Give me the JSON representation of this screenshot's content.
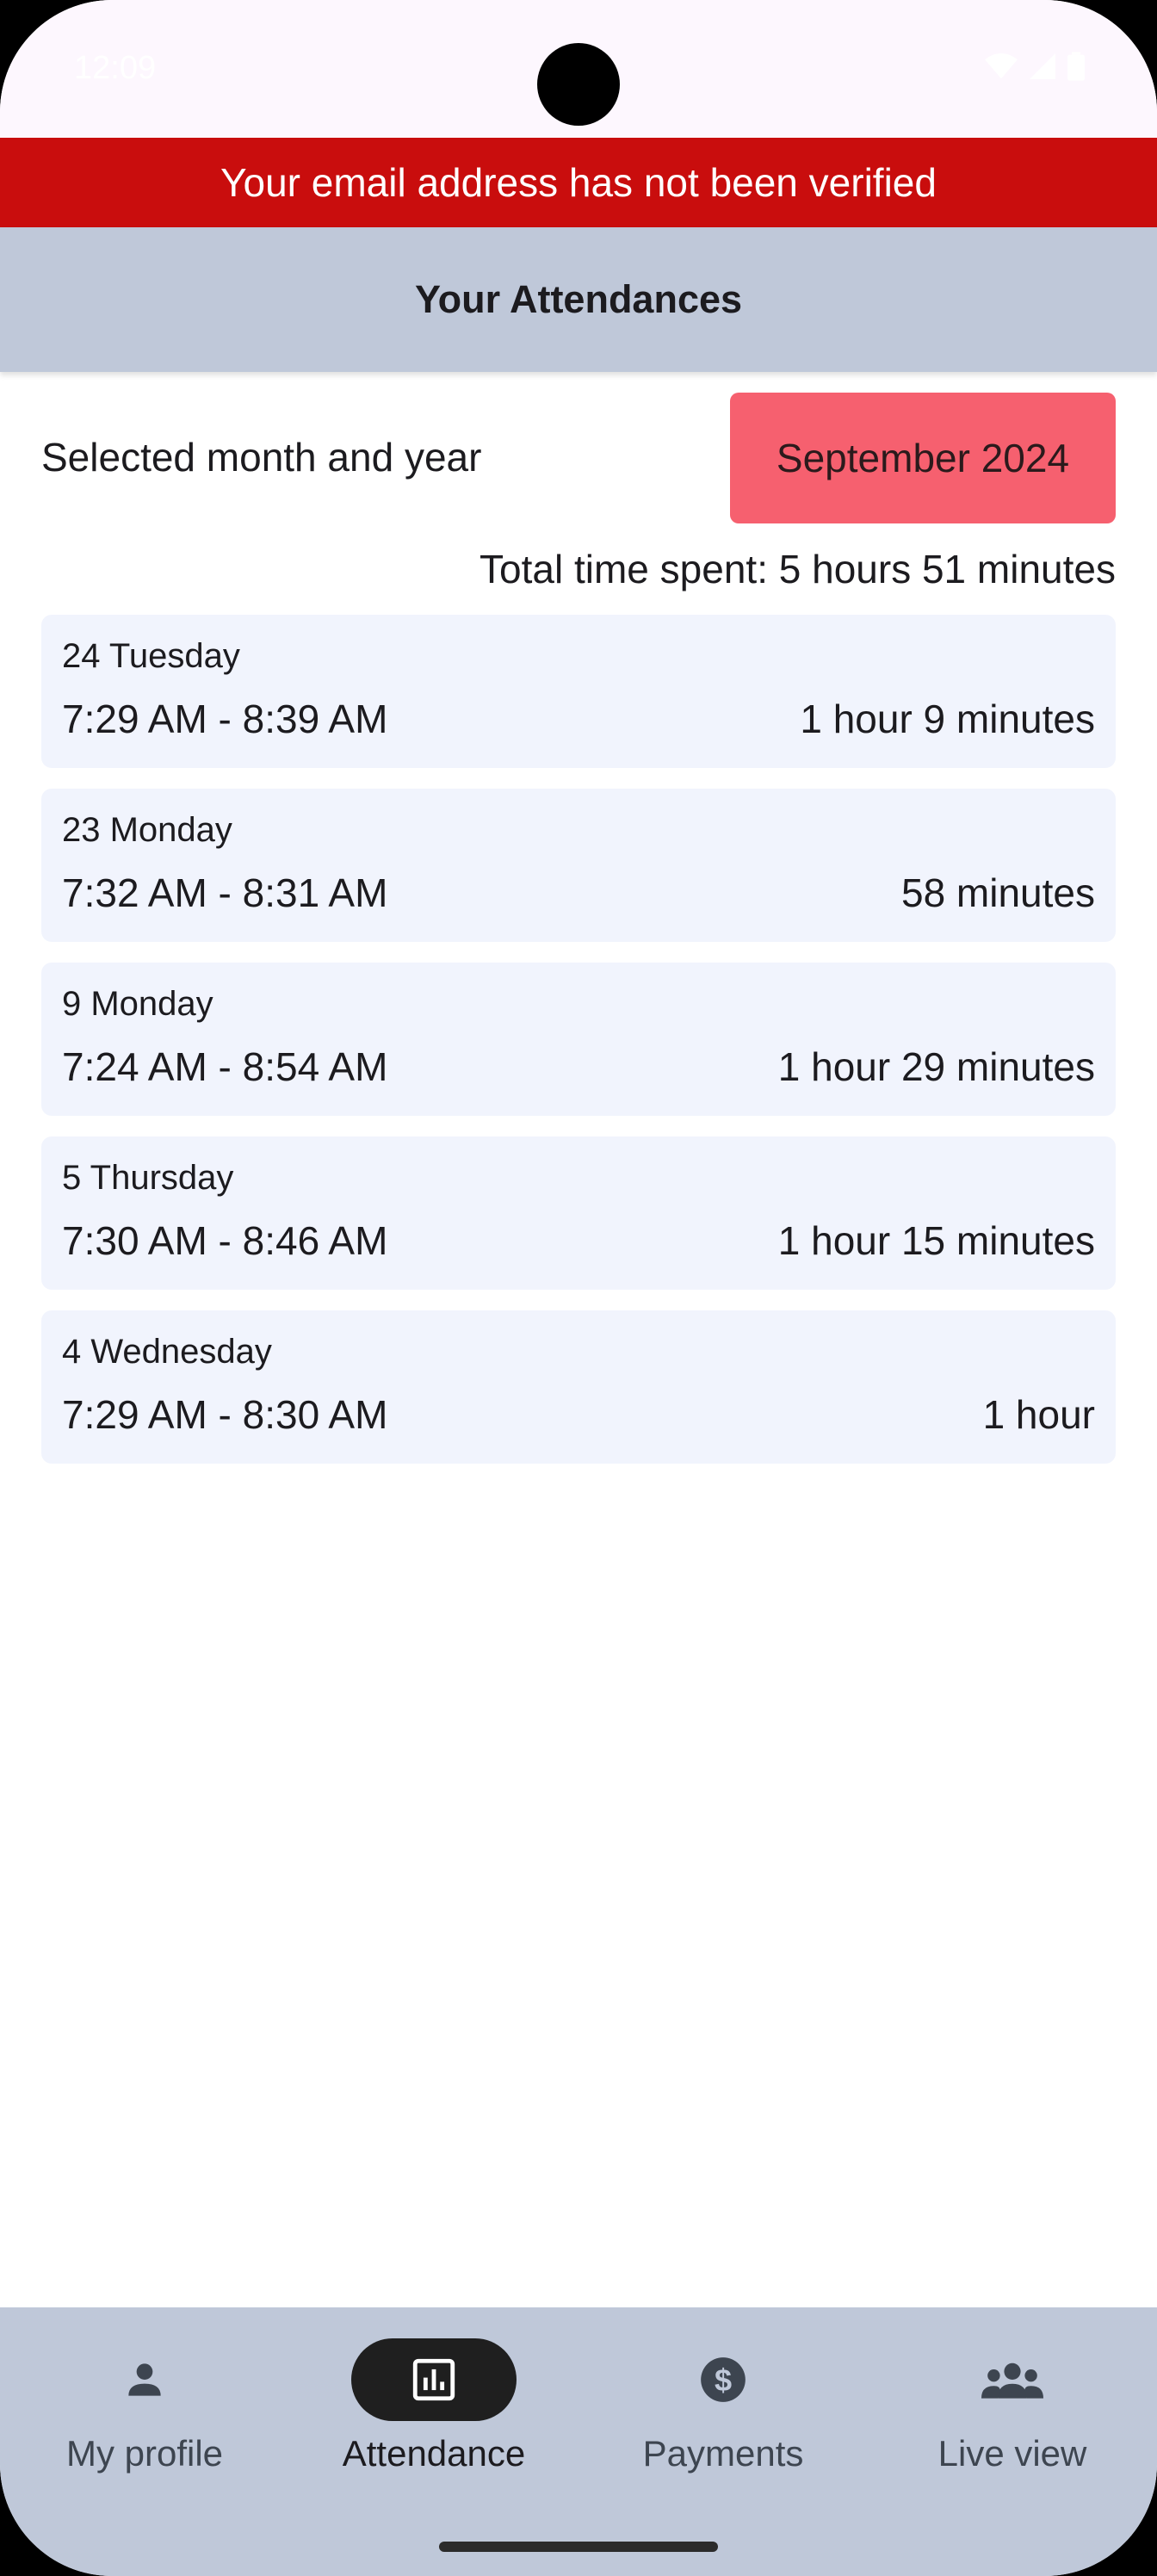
{
  "status_bar": {
    "time": "12:09"
  },
  "banner": {
    "text": "Your email address has not been verified"
  },
  "app_bar": {
    "title": "Your Attendances"
  },
  "month_selector": {
    "label": "Selected month and year",
    "value": "September 2024"
  },
  "summary": {
    "total_time": "Total time spent: 5 hours 51 minutes"
  },
  "attendances": [
    {
      "day": "24 Tuesday",
      "range": "7:29 AM - 8:39 AM",
      "duration": "1 hour 9 minutes"
    },
    {
      "day": "23 Monday",
      "range": "7:32 AM - 8:31 AM",
      "duration": "58 minutes"
    },
    {
      "day": "9 Monday",
      "range": "7:24 AM - 8:54 AM",
      "duration": "1 hour 29 minutes"
    },
    {
      "day": "5 Thursday",
      "range": "7:30 AM - 8:46 AM",
      "duration": "1 hour 15 minutes"
    },
    {
      "day": "4 Wednesday",
      "range": "7:29 AM - 8:30 AM",
      "duration": "1 hour"
    }
  ],
  "bottom_nav": {
    "items": [
      {
        "label": "My profile",
        "icon": "person-icon"
      },
      {
        "label": "Attendance",
        "icon": "bar-chart-icon",
        "active": true
      },
      {
        "label": "Payments",
        "icon": "dollar-circle-icon"
      },
      {
        "label": "Live view",
        "icon": "group-icon"
      }
    ]
  },
  "colors": {
    "banner": "#c90d0d",
    "app_bar": "#bfc8d9",
    "month_button": "#f6606f",
    "list_item": "#f1f4fd",
    "nav_active": "#1f1f1f"
  }
}
